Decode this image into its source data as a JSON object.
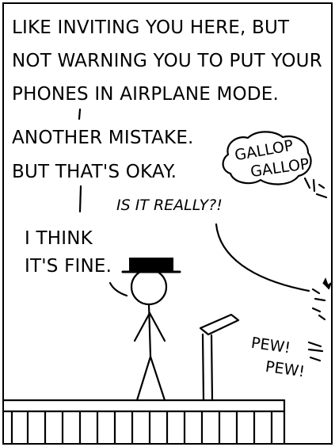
{
  "comic": {
    "narration": [
      "LIKE INVITING YOU HERE, BUT",
      "NOT WARNING YOU TO PUT YOUR",
      "PHONES IN AIRPLANE MODE."
    ],
    "speaker_lines": [
      "ANOTHER MISTAKE.",
      "BUT THAT'S OKAY."
    ],
    "offstage_shout": "IS IT REALLY?!",
    "reply_lines": [
      "I THINK",
      "IT'S FINE."
    ],
    "sfx_gallop": [
      "GALLOP",
      "GALLOP"
    ],
    "sfx_pew": [
      "PEW!",
      "PEW!"
    ]
  }
}
